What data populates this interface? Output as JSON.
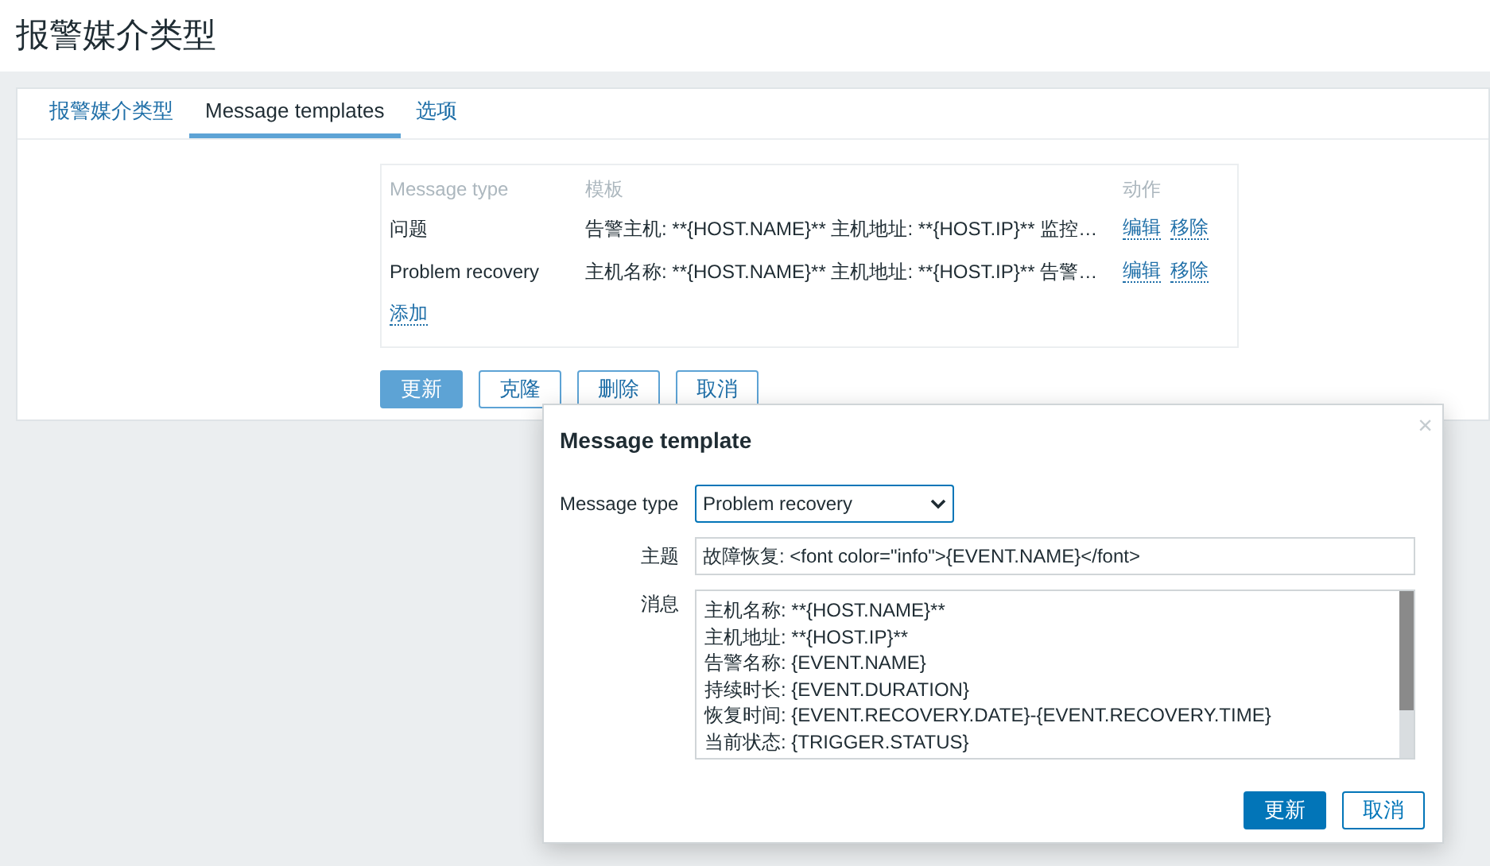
{
  "page_title": "报警媒介类型",
  "tabs": [
    {
      "label": "报警媒介类型",
      "selected": false
    },
    {
      "label": "Message templates",
      "selected": true
    },
    {
      "label": "选项",
      "selected": false
    }
  ],
  "table": {
    "columns": [
      "Message type",
      "模板",
      "动作"
    ],
    "rows": [
      {
        "type": "问题",
        "template": "告警主机: **{HOST.NAME}** 主机地址: **{HOST.IP}** 监控…",
        "actions": [
          "编辑",
          "移除"
        ]
      },
      {
        "type": "Problem recovery",
        "template": "主机名称: **{HOST.NAME}** 主机地址: **{HOST.IP}** 告警…",
        "actions": [
          "编辑",
          "移除"
        ]
      }
    ],
    "add_link": "添加"
  },
  "form_buttons": [
    {
      "label": "更新",
      "kind": "primary"
    },
    {
      "label": "克隆",
      "kind": "secondary"
    },
    {
      "label": "删除",
      "kind": "secondary"
    },
    {
      "label": "取消",
      "kind": "secondary"
    }
  ],
  "dialog": {
    "title": "Message template",
    "close": "×",
    "message_type": {
      "label": "Message type",
      "value": "Problem recovery"
    },
    "subject": {
      "label": "主题",
      "value": "故障恢复: <font color=\"info\">{EVENT.NAME}</font>"
    },
    "message": {
      "label": "消息",
      "lines": [
        "主机名称: **{HOST.NAME}**",
        "主机地址: **{HOST.IP}**",
        "告警名称: {EVENT.NAME}",
        "持续时长: {EVENT.DURATION}",
        "恢复时间: {EVENT.RECOVERY.DATE}-{EVENT.RECOVERY.TIME}",
        "当前状态: {TRIGGER.STATUS}"
      ]
    },
    "buttons": [
      {
        "label": "更新",
        "kind": "primary"
      },
      {
        "label": "取消",
        "kind": "secondary"
      }
    ]
  }
}
